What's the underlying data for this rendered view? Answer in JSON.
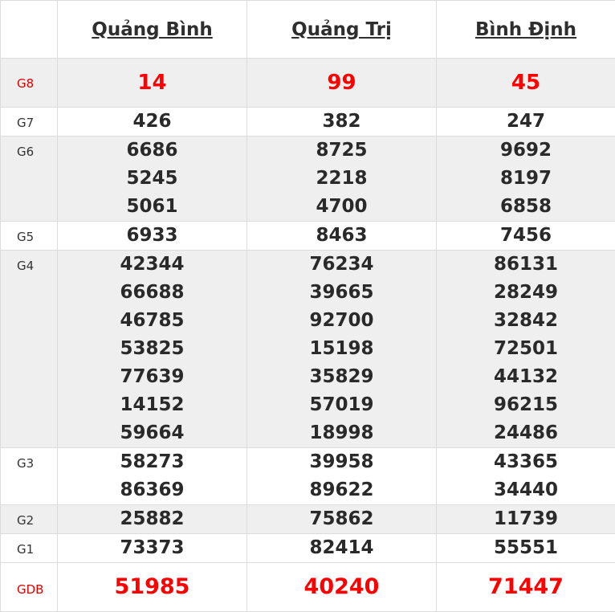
{
  "headers": [
    "Quảng Bình",
    "Quảng Trị",
    "Bình Định"
  ],
  "prizes": [
    {
      "label": "G8",
      "values": [
        [
          "14"
        ],
        [
          "99"
        ],
        [
          "45"
        ]
      ]
    },
    {
      "label": "G7",
      "values": [
        [
          "426"
        ],
        [
          "382"
        ],
        [
          "247"
        ]
      ]
    },
    {
      "label": "G6",
      "values": [
        [
          "6686",
          "5245",
          "5061"
        ],
        [
          "8725",
          "2218",
          "4700"
        ],
        [
          "9692",
          "8197",
          "6858"
        ]
      ]
    },
    {
      "label": "G5",
      "values": [
        [
          "6933"
        ],
        [
          "8463"
        ],
        [
          "7456"
        ]
      ]
    },
    {
      "label": "G4",
      "values": [
        [
          "42344",
          "66688",
          "46785",
          "53825",
          "77639",
          "14152",
          "59664"
        ],
        [
          "76234",
          "39665",
          "92700",
          "15198",
          "35829",
          "57019",
          "18998"
        ],
        [
          "86131",
          "28249",
          "32842",
          "72501",
          "44132",
          "96215",
          "24486"
        ]
      ]
    },
    {
      "label": "G3",
      "values": [
        [
          "58273",
          "86369"
        ],
        [
          "39958",
          "89622"
        ],
        [
          "43365",
          "34440"
        ]
      ]
    },
    {
      "label": "G2",
      "values": [
        [
          "25882"
        ],
        [
          "75862"
        ],
        [
          "11739"
        ]
      ]
    },
    {
      "label": "G1",
      "values": [
        [
          "73373"
        ],
        [
          "82414"
        ],
        [
          "55551"
        ]
      ]
    },
    {
      "label": "GDB",
      "values": [
        [
          "51985"
        ],
        [
          "40240"
        ],
        [
          "71447"
        ]
      ]
    }
  ],
  "colors": {
    "highlight": "#ff0000",
    "shaded_row": "#efefef",
    "text": "#2a2a2a"
  }
}
